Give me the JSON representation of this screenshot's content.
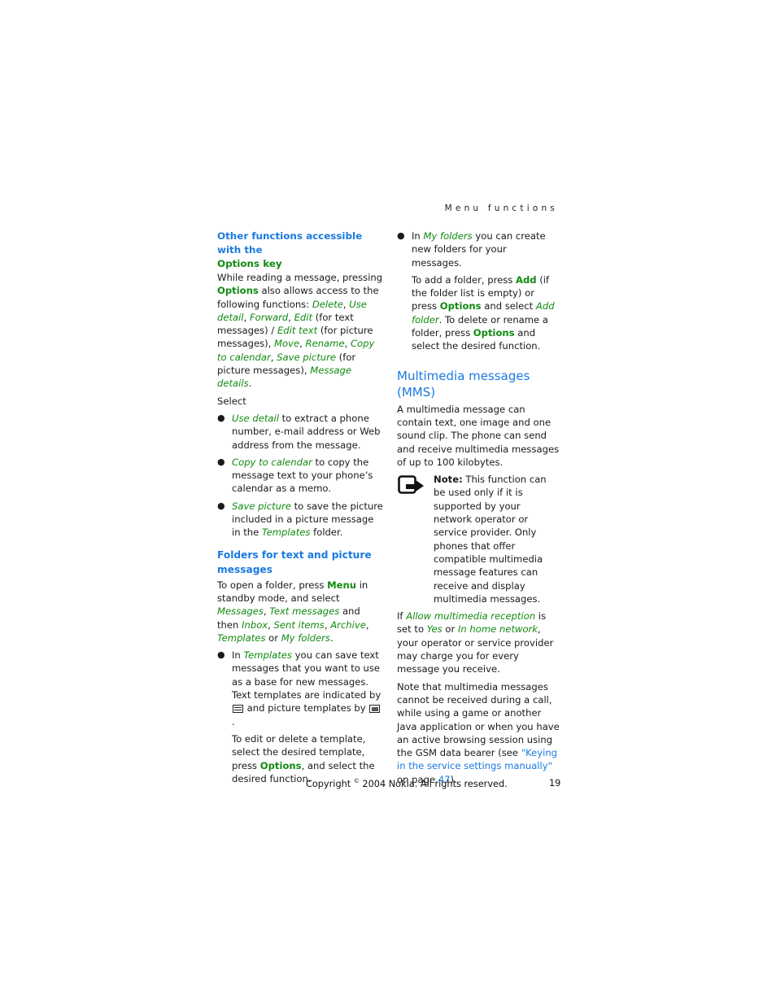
{
  "header": {
    "running_head": "Menu functions"
  },
  "left": {
    "section1": {
      "heading_part1": "Other functions accessible with the",
      "heading_part2": "Options key",
      "intro": [
        "While reading a message, pressing ",
        "Options",
        " also allows access to the following functions: ",
        "Delete",
        ", ",
        "Use detail",
        ", ",
        "Forward",
        ", ",
        "Edit",
        " (for text messages) / ",
        "Edit text",
        " (for picture messages), ",
        "Move",
        ", ",
        "Rename",
        ", ",
        "Copy to calendar",
        ", ",
        "Save picture",
        " (for picture messages), ",
        "Message details",
        "."
      ],
      "select_label": "Select",
      "bullets": [
        {
          "opt": "Use detail",
          "text": " to extract a phone number, e-mail address or Web address from the message."
        },
        {
          "opt": "Copy to calendar",
          "text": " to copy the message text to your phone’s calendar as a memo."
        },
        {
          "opt": "Save picture",
          "text": " to save the picture included in a picture message in the ",
          "opt2": "Templates",
          "text2": " folder."
        }
      ]
    },
    "section2": {
      "heading": "Folders for text and picture messages",
      "intro": [
        "To open a folder, press ",
        "Menu",
        " in standby mode, and select ",
        "Messages",
        ", ",
        "Text messages",
        " and then ",
        "Inbox",
        ", ",
        "Sent items",
        ", ",
        "Archive",
        ", ",
        "Templates",
        " or ",
        "My folders",
        "."
      ],
      "bullet_templates": {
        "prefix": "In ",
        "opt": "Templates",
        "text1": " you can save text messages that you want to use as a base for new messages. Text templates are indicated by ",
        "text2": " and picture templates by ",
        "text3": ".",
        "icons": [
          "text-template-icon",
          "picture-template-icon"
        ],
        "sub_p1": "To edit or delete a template, select the desired template, press ",
        "sub_key": "Options",
        "sub_p2": ", and select the desired function."
      }
    }
  },
  "right": {
    "bullet_myfolders": {
      "prefix": "In ",
      "opt": "My folders",
      "text": " you can create new folders for your messages.",
      "sub": [
        "To add a folder, press ",
        "Add",
        " (if the folder list is empty) or press ",
        "Options",
        " and select ",
        "Add folder",
        ". To delete or rename a folder, press ",
        "Options",
        " and select the desired function."
      ]
    },
    "mms": {
      "heading": "Multimedia messages (MMS)",
      "intro": "A multimedia message can contain text, one image and one sound clip. The phone can send and receive multimedia messages of up to 100 kilobytes.",
      "note_label": "Note:",
      "note_text": " This function can be used only if it is supported by your network operator or service provider. Only phones that offer compatible multimedia message features can receive and display multimedia messages.",
      "charge": [
        "If ",
        "Allow multimedia reception",
        " is set to ",
        "Yes",
        " or ",
        "In home network",
        ", your operator or service provider may charge you for every message you receive."
      ],
      "note2": [
        "Note that multimedia messages cannot be received during a call, while using a game or another Java application or when you have an active browsing session using the GSM data bearer (see ",
        "\"Keying in the service settings manually\"",
        " on page ",
        "47",
        ")."
      ]
    }
  },
  "footer": {
    "copyright_pre": "Copyright ",
    "copyright_symbol": "©",
    "copyright_post": " 2004 Nokia. All rights reserved.",
    "page_number": "19"
  },
  "colors": {
    "heading_blue": "#1a7ae0",
    "option_green": "#118a11",
    "text": "#1a1a1a"
  }
}
